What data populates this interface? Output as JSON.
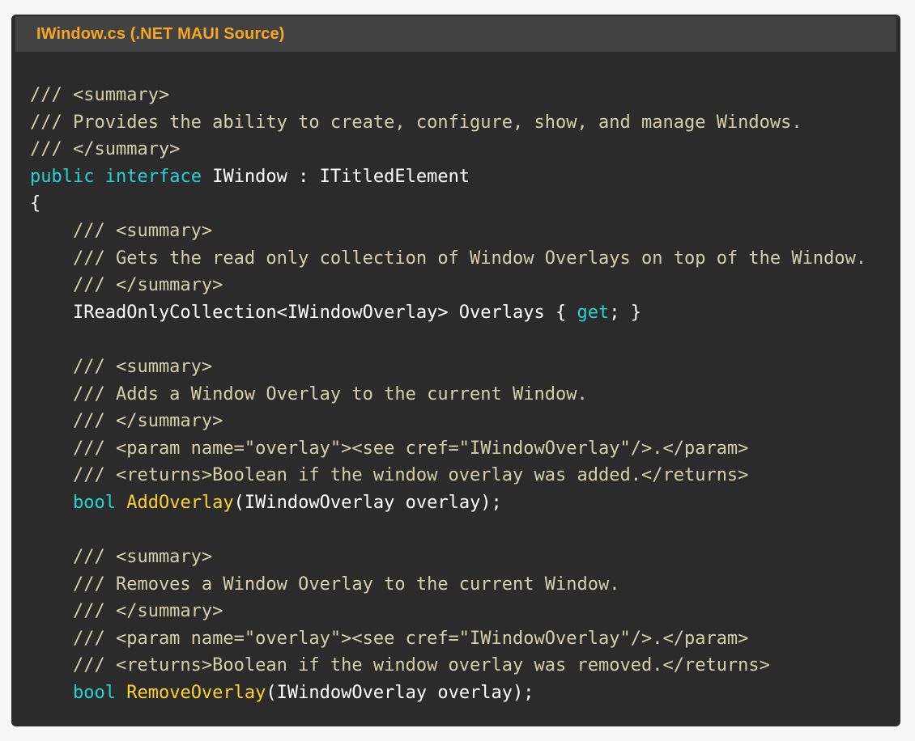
{
  "window": {
    "title": "IWindow.cs (.NET MAUI Source)"
  },
  "colors": {
    "background": "#f6f6f6",
    "panel": "#2b2b2b",
    "title_bar": "#424242",
    "title_text": "#f5a623",
    "comment": "#d6d0a8",
    "keyword": "#24d4d4",
    "method": "#ffd12e",
    "plain": "#ffffff"
  },
  "code": {
    "lines": [
      [
        {
          "t": "c",
          "s": "/// <summary>"
        }
      ],
      [
        {
          "t": "c",
          "s": "/// Provides the ability to create, configure, show, and manage Windows."
        }
      ],
      [
        {
          "t": "c",
          "s": "/// </summary>"
        }
      ],
      [
        {
          "t": "k",
          "s": "public"
        },
        {
          "t": "p",
          "s": " "
        },
        {
          "t": "k",
          "s": "interface"
        },
        {
          "t": "p",
          "s": " IWindow : ITitledElement"
        }
      ],
      [
        {
          "t": "p",
          "s": "{"
        }
      ],
      [
        {
          "t": "c",
          "s": "    /// <summary>"
        }
      ],
      [
        {
          "t": "c",
          "s": "    /// Gets the read only collection of Window Overlays on top of the Window."
        }
      ],
      [
        {
          "t": "c",
          "s": "    /// </summary>"
        }
      ],
      [
        {
          "t": "p",
          "s": "    IReadOnlyCollection<IWindowOverlay> Overlays { "
        },
        {
          "t": "k",
          "s": "get"
        },
        {
          "t": "p",
          "s": "; }"
        }
      ],
      [
        {
          "t": "p",
          "s": ""
        }
      ],
      [
        {
          "t": "c",
          "s": "    /// <summary>"
        }
      ],
      [
        {
          "t": "c",
          "s": "    /// Adds a Window Overlay to the current Window."
        }
      ],
      [
        {
          "t": "c",
          "s": "    /// </summary>"
        }
      ],
      [
        {
          "t": "c",
          "s": "    /// <param name=\"overlay\"><see cref=\"IWindowOverlay\"/>.</param>"
        }
      ],
      [
        {
          "t": "c",
          "s": "    /// <returns>Boolean if the window overlay was added.</returns>"
        }
      ],
      [
        {
          "t": "p",
          "s": "    "
        },
        {
          "t": "k",
          "s": "bool"
        },
        {
          "t": "p",
          "s": " "
        },
        {
          "t": "f",
          "s": "AddOverlay"
        },
        {
          "t": "p",
          "s": "(IWindowOverlay overlay);"
        }
      ],
      [
        {
          "t": "p",
          "s": ""
        }
      ],
      [
        {
          "t": "c",
          "s": "    /// <summary>"
        }
      ],
      [
        {
          "t": "c",
          "s": "    /// Removes a Window Overlay to the current Window."
        }
      ],
      [
        {
          "t": "c",
          "s": "    /// </summary>"
        }
      ],
      [
        {
          "t": "c",
          "s": "    /// <param name=\"overlay\"><see cref=\"IWindowOverlay\"/>.</param>"
        }
      ],
      [
        {
          "t": "c",
          "s": "    /// <returns>Boolean if the window overlay was removed.</returns>"
        }
      ],
      [
        {
          "t": "p",
          "s": "    "
        },
        {
          "t": "k",
          "s": "bool"
        },
        {
          "t": "p",
          "s": " "
        },
        {
          "t": "f",
          "s": "RemoveOverlay"
        },
        {
          "t": "p",
          "s": "(IWindowOverlay overlay);"
        }
      ]
    ]
  }
}
